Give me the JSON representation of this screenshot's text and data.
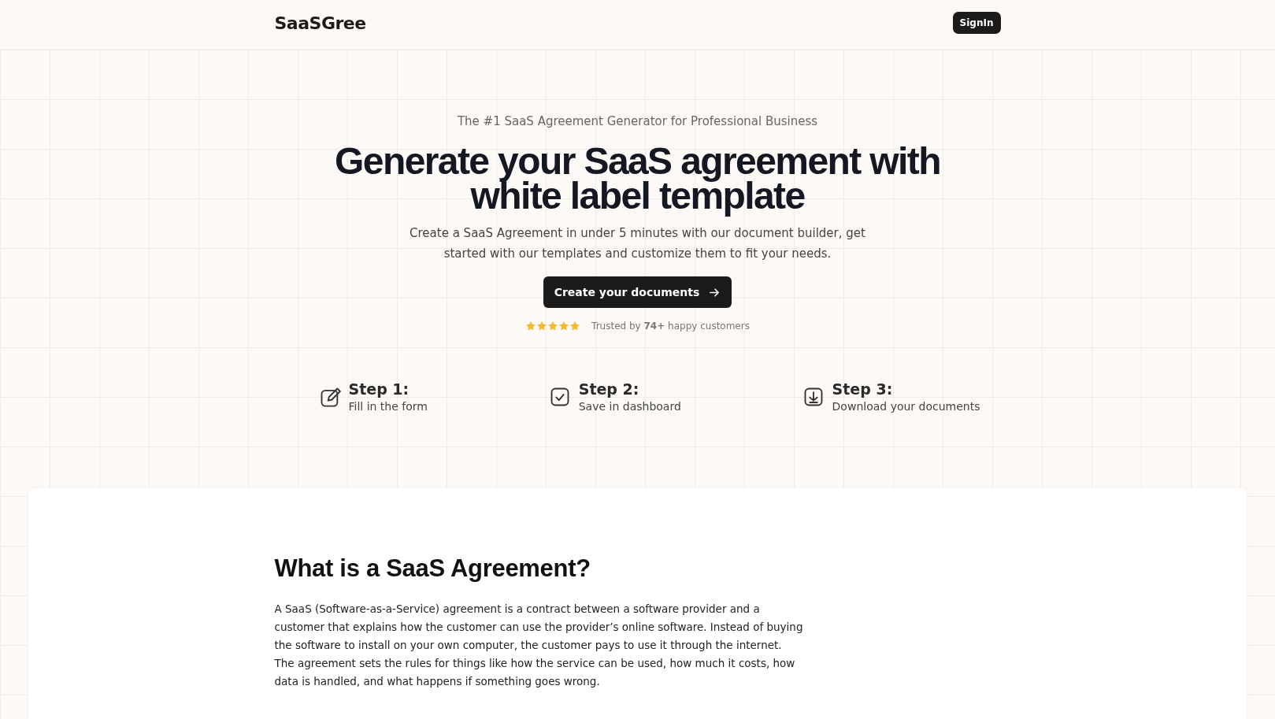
{
  "header": {
    "logo": "SaaSGree",
    "signin": "SignIn"
  },
  "hero": {
    "eyebrow": "The #1 SaaS Agreement Generator for Professional Business",
    "title": "Generate your SaaS agreement with white label template",
    "subtitle": "Create a SaaS Agreement in under 5 minutes with our document builder, get started with our templates and customize them to fit your needs.",
    "cta": "Create your documents",
    "rating": {
      "stars": 5,
      "text": "Trusted by **74+** happy customers"
    }
  },
  "steps": [
    {
      "kind": "edit",
      "title": "Step 1:",
      "text": "Fill in the form"
    },
    {
      "kind": "check",
      "title": "Step 2:",
      "text": "Save in dashboard"
    },
    {
      "kind": "download",
      "title": "Step 3:",
      "text": "Download your documents"
    }
  ],
  "article": {
    "heading": "What is a SaaS Agreement?",
    "body": "A SaaS (Software-as-a-Service) agreement is a contract between a software provider and a customer that explains how the customer can use the provider’s online software. Instead of buying the software to install on your own computer, the customer pays to use it through the internet. The agreement sets the rules for things like how the service can be used, how much it costs, how data is handled, and what happens if something goes wrong."
  }
}
